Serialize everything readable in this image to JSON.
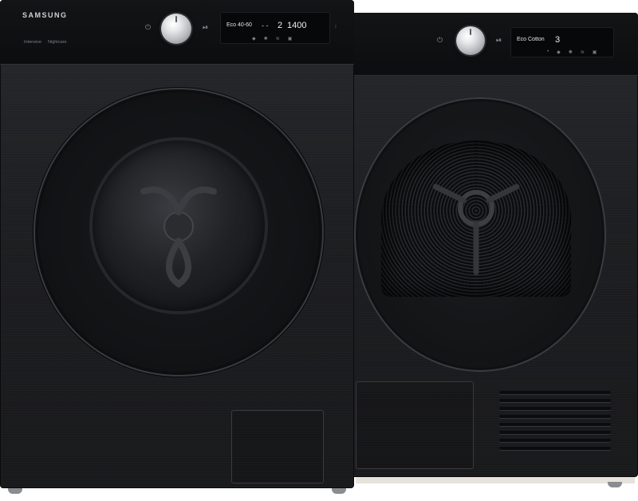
{
  "scene": {
    "description_free": true,
    "accent_colors": {
      "body": "#1e1f22",
      "strip": "#0e0f11",
      "chrome": "#d9dadd",
      "display_text": "#e6e7ea"
    }
  },
  "washer": {
    "brand": "SAMSUNG",
    "labels": [
      "Intensive",
      "Nightcare"
    ],
    "corner_label": "",
    "display": {
      "program": "Eco 40-60",
      "dashes": "- -",
      "temp": "2",
      "spin": "1400"
    },
    "icons": [
      "power-icon",
      "play-pause-icon",
      "wifi-icon",
      "lock-icon"
    ]
  },
  "dryer": {
    "display": {
      "program": "Eco Cotton",
      "value": "3"
    },
    "icons": [
      "power-icon",
      "play-pause-icon",
      "wifi-icon"
    ]
  }
}
